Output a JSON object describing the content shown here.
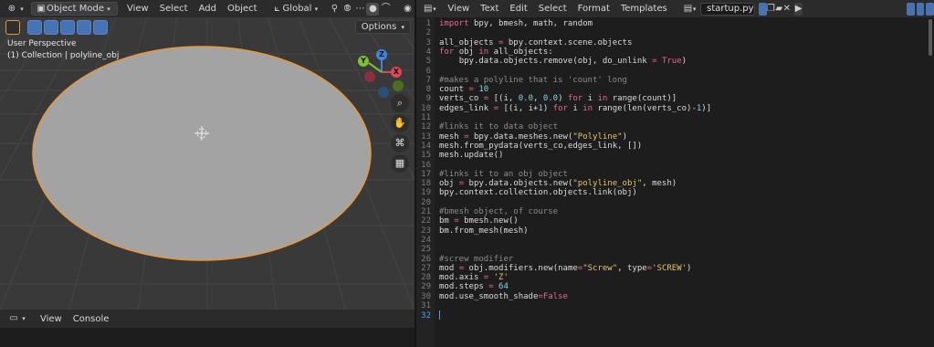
{
  "viewport_header": {
    "mode_label": "Object Mode",
    "menus": [
      "View",
      "Select",
      "Add",
      "Object"
    ],
    "transform_orientation": "Global"
  },
  "viewport": {
    "options_label": "Options",
    "perspective_text": "User Perspective",
    "collection_text": "(1) Collection | polyline_obj",
    "gizmo": {
      "x": "X",
      "y": "Y",
      "z": "Z"
    },
    "nav_icons": [
      "zoom-icon",
      "hand-pan-icon",
      "camera-icon",
      "grid-view-icon"
    ]
  },
  "console_header": {
    "menus": [
      "View",
      "Console"
    ]
  },
  "editor_header": {
    "menus": [
      "View",
      "Text",
      "Edit",
      "Select",
      "Format",
      "Templates"
    ],
    "filename": "startup.py"
  },
  "code_lines": [
    "import bpy, bmesh, math, random",
    "",
    "all_objects = bpy.context.scene.objects",
    "for obj in all_objects:",
    "    bpy.data.objects.remove(obj, do_unlink = True)",
    "",
    "#makes a polyline that is 'count' long",
    "count = 10",
    "verts_co = [(i, 0.0, 0.0) for i in range(count)]",
    "edges_link = [(i, i+1) for i in range(len(verts_co)-1)]",
    "",
    "#links it to data object",
    "mesh = bpy.data.meshes.new(\"Polyline\")",
    "mesh.from_pydata(verts_co,edges_link, [])",
    "mesh.update()",
    "",
    "#links it to an obj object",
    "obj = bpy.data.objects.new(\"polyline_obj\", mesh)",
    "bpy.context.collection.objects.link(obj)",
    "",
    "#bmesh object, of course",
    "bm = bmesh.new()",
    "bm.from_mesh(mesh)",
    "",
    "",
    "#screw modifier",
    "mod = obj.modifiers.new(name=\"Screw\", type='SCREW')",
    "mod.axis = 'Z'",
    "mod.steps = 64",
    "mod.use_smooth_shade=False",
    "",
    ""
  ],
  "colors": {
    "selection_outline": "#e8983a",
    "keyword": "#e06b8c",
    "string": "#e6c46e",
    "number": "#8ad1e3",
    "comment": "#8b8b8b",
    "axis_x": "#e0465a",
    "axis_y": "#7fbf30",
    "axis_z": "#3d86e0"
  }
}
